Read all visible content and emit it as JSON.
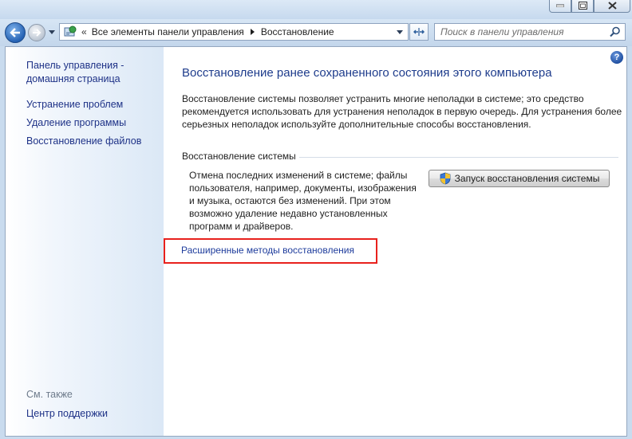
{
  "window": {
    "controls": [
      "minimize",
      "maximize",
      "close"
    ]
  },
  "navbar": {
    "back_icon": "back-arrow-icon",
    "forward_icon": "forward-arrow-icon",
    "address_separator": "«",
    "breadcrumb": [
      "Все элементы панели управления",
      "Восстановление"
    ],
    "search_placeholder": "Поиск в панели управления"
  },
  "sidebar": {
    "home_link": "Панель управления - домашняя страница",
    "links": [
      "Устранение проблем",
      "Удаление программы",
      "Восстановление файлов"
    ],
    "see_also_label": "См. также",
    "see_also_links": [
      "Центр поддержки"
    ]
  },
  "main": {
    "help_label": "?",
    "heading": "Восстановление ранее сохраненного состояния этого компьютера",
    "intro": "Восстановление системы позволяет устранить многие неполадки в системе; это средство рекомендуется использовать для устранения неполадок в первую очередь. Для устранения более серьезных неполадок используйте дополнительные способы восстановления.",
    "section_title": "Восстановление системы",
    "section_desc": "Отмена последних изменений в системе; файлы пользователя, например, документы, изображения и музыка, остаются без изменений. При этом возможно удаление недавно установленных программ и драйверов.",
    "restore_button": "Запуск восстановления системы",
    "advanced_link": "Расширенные методы восстановления"
  },
  "colors": {
    "highlight_box": "#e8211d",
    "link": "#1e3c9c",
    "heading": "#1e3c8c"
  }
}
